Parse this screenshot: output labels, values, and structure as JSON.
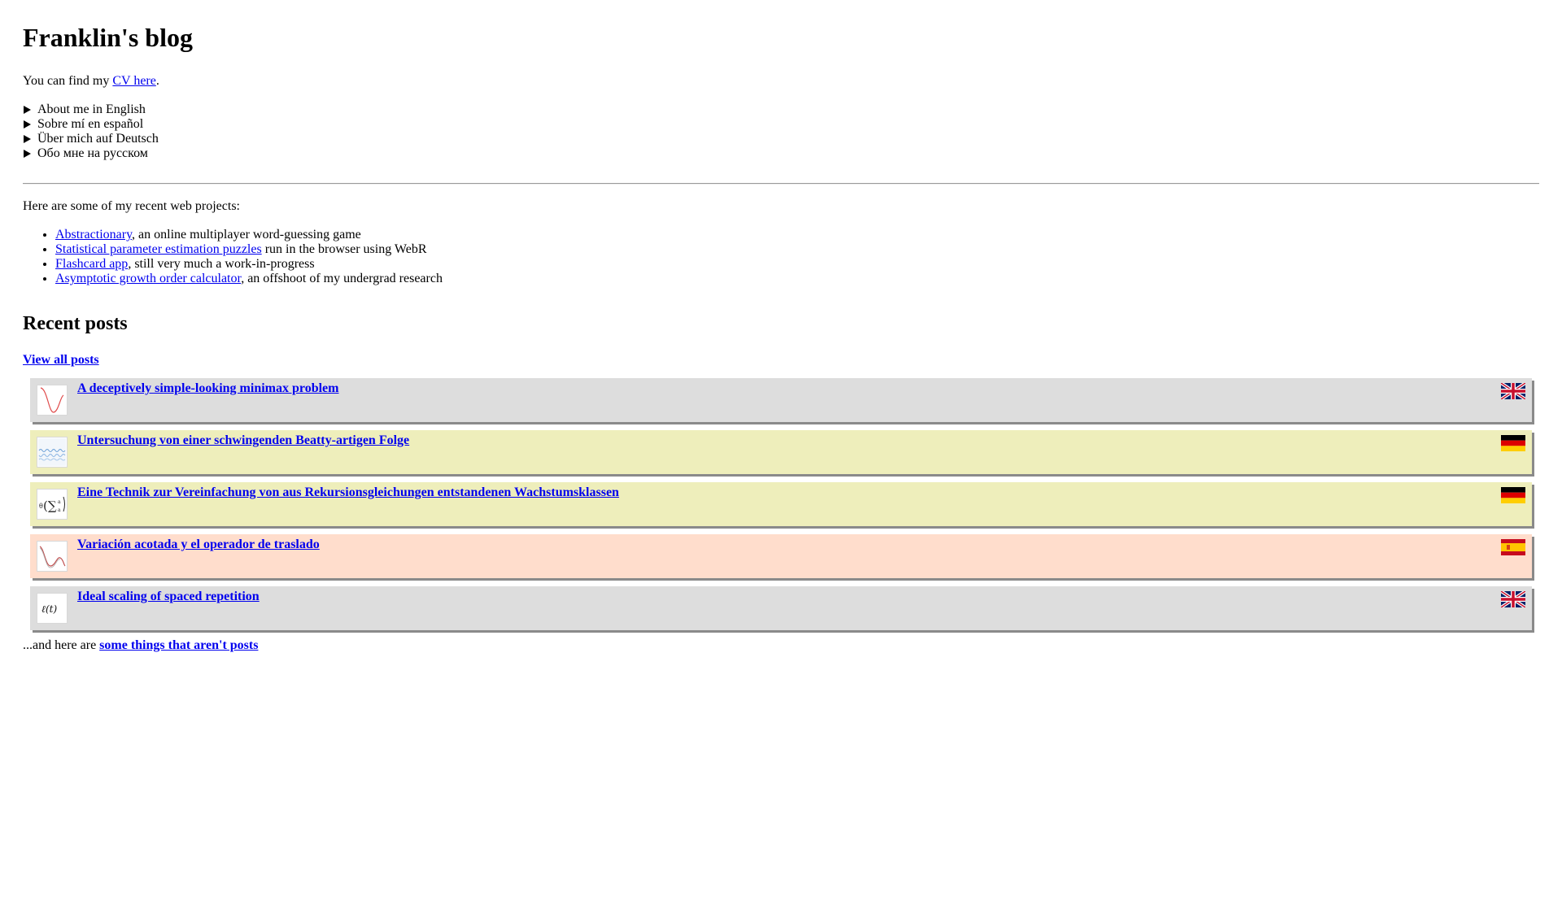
{
  "header": {
    "title": "Franklin's blog"
  },
  "cv": {
    "prefix": "You can find my ",
    "link": "CV here",
    "suffix": "."
  },
  "about": [
    "About me in English",
    "Sobre mí en español",
    "Über mich auf Deutsch",
    "Обо мне на русском"
  ],
  "projects": {
    "intro": "Here are some of my recent web projects:",
    "items": [
      {
        "link": "Abstractionary",
        "rest": ", an online multiplayer word-guessing game"
      },
      {
        "link": "Statistical parameter estimation puzzles",
        "rest": " run in the browser using WebR"
      },
      {
        "link": "Flashcard app",
        "rest": ", still very much a work-in-progress"
      },
      {
        "link": "Asymptotic growth order calculator",
        "rest": ", an offshoot of my undergrad research"
      }
    ]
  },
  "recent": {
    "heading": "Recent posts",
    "view_all": "View all posts",
    "posts": [
      {
        "title": "A deceptively simple-looking minimax problem",
        "lang": "uk-flag-icon",
        "bg": "#dddddd",
        "thumb": "curve-thumb-icon"
      },
      {
        "title": "Untersuchung von einer schwingenden Beatty-artigen Folge",
        "lang": "de-flag-icon",
        "bg": "#eeeebb",
        "thumb": "oscillation-thumb-icon"
      },
      {
        "title": "Eine Technik zur Vereinfachung von aus Rekursionsgleichungen entstandenen Wachstumsklassen",
        "lang": "de-flag-icon",
        "bg": "#eeeebb",
        "thumb": "formula-thumb-icon"
      },
      {
        "title": "Variación acotada y el operador de traslado",
        "lang": "es-flag-icon",
        "bg": "#ffddcc",
        "thumb": "wave-thumb-icon"
      },
      {
        "title": "Ideal scaling of spaced repetition",
        "lang": "uk-flag-icon",
        "bg": "#dddddd",
        "thumb": "ell-thumb-icon"
      }
    ]
  },
  "footer": {
    "prefix": "...and here are ",
    "link": "some things that aren't posts"
  },
  "thumb_text": {
    "formula_theta": "θ",
    "formula_sum": "(∑",
    "formula_frac": "a",
    "ell": "ℓ(t)"
  }
}
